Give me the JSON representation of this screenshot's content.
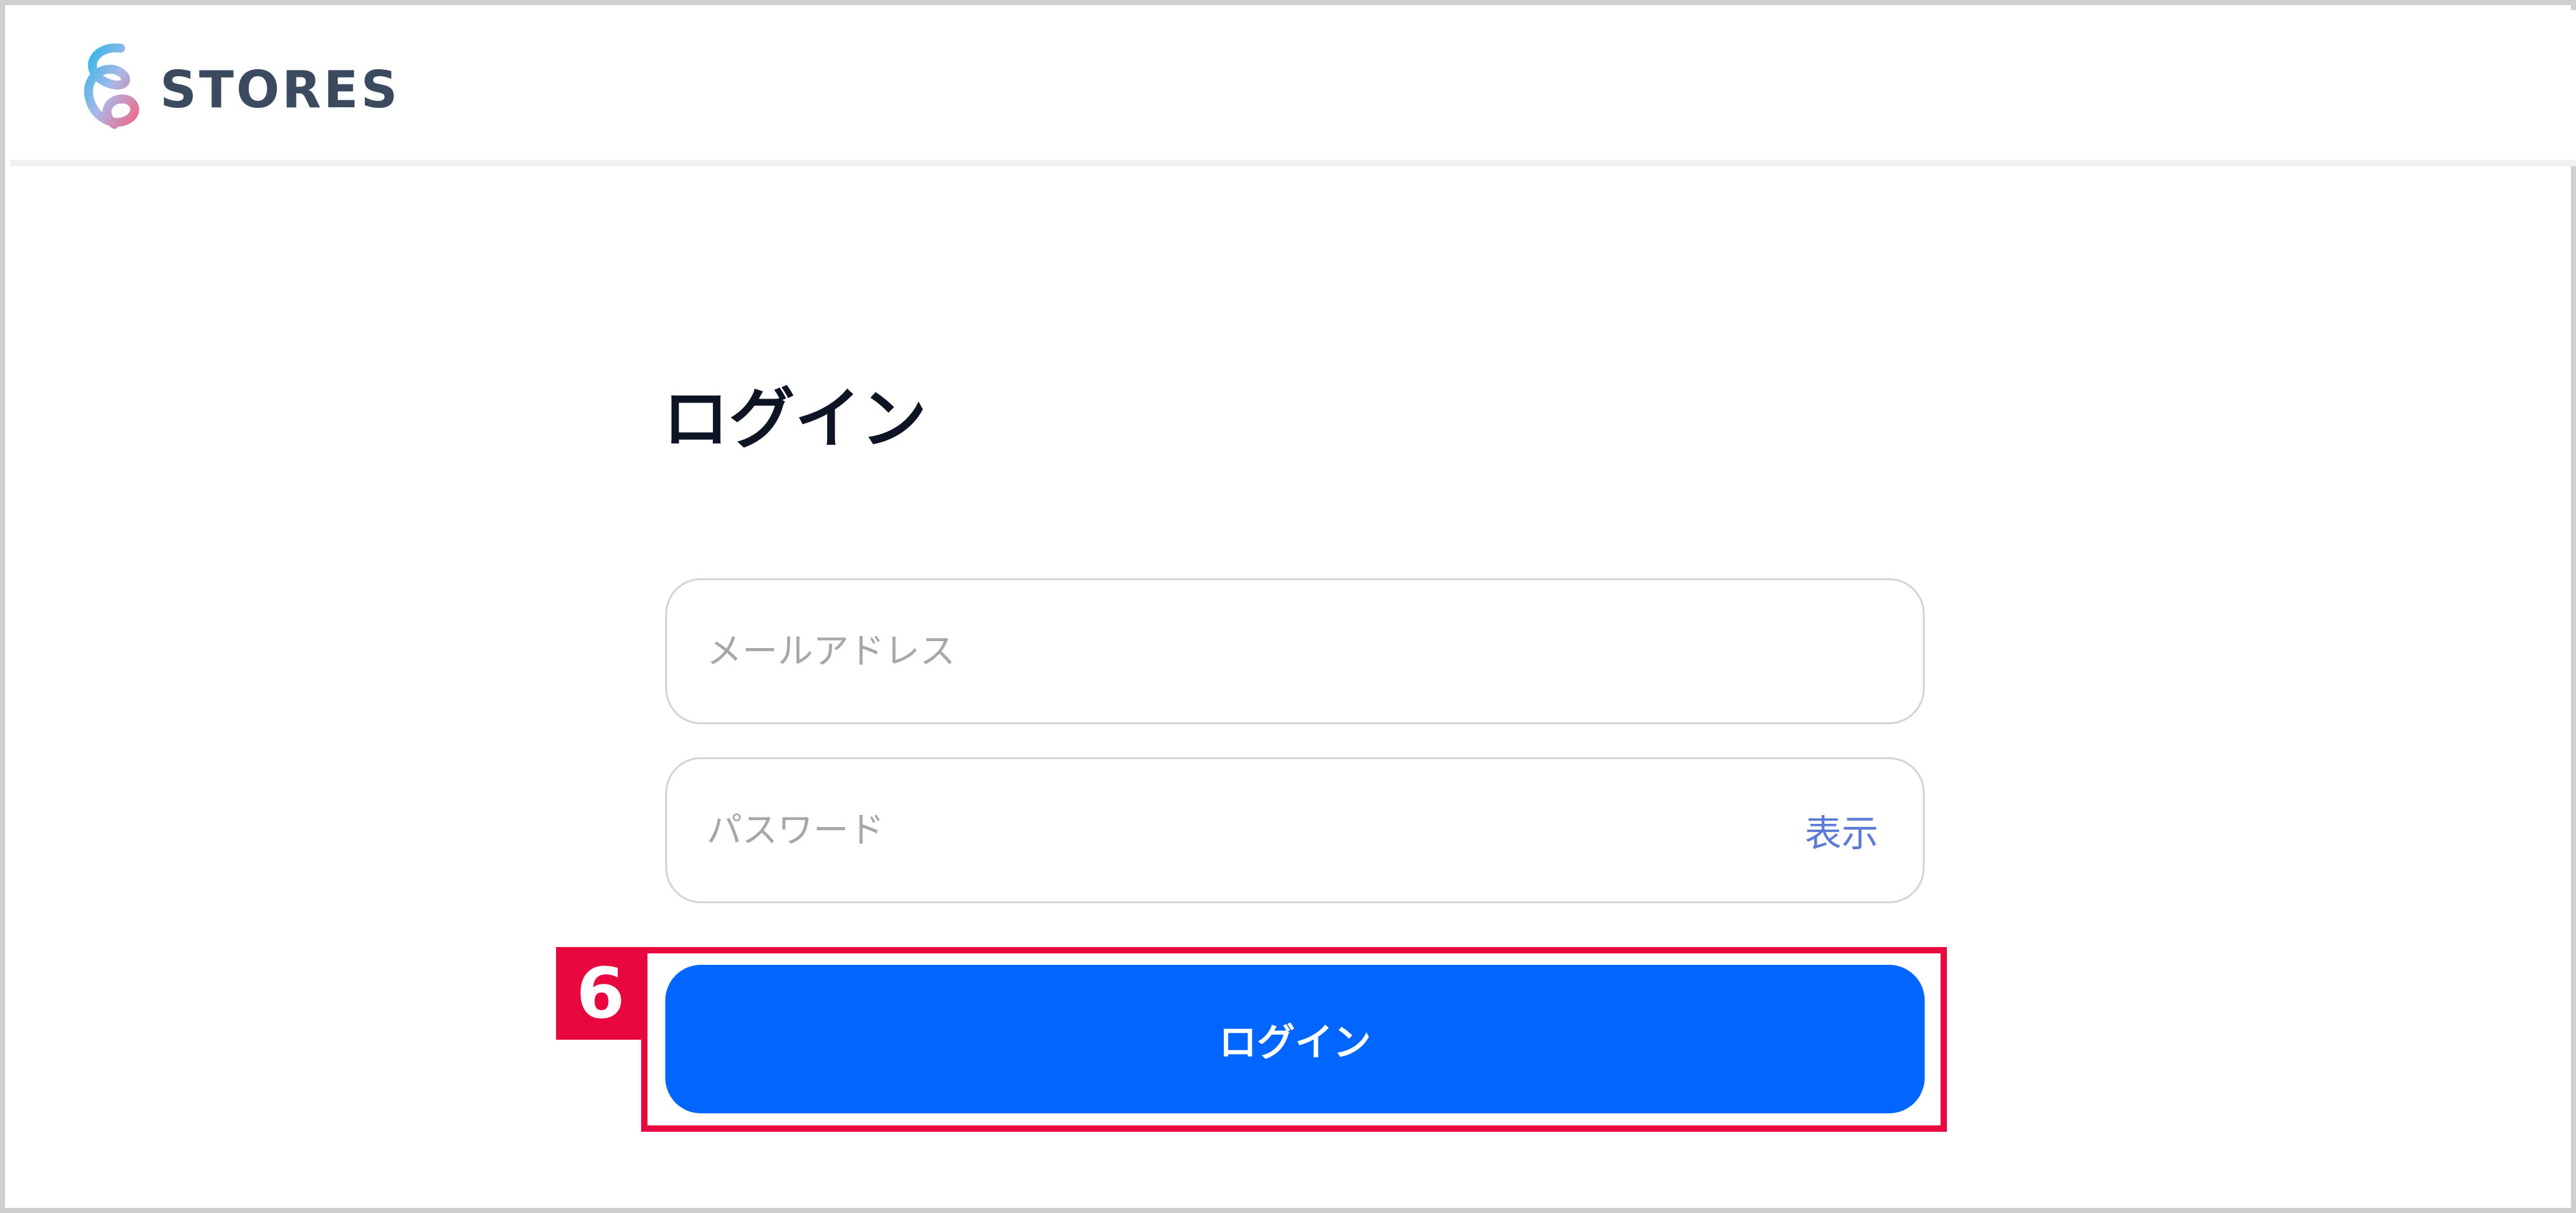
{
  "header": {
    "brand_name": "STORES",
    "logo_icon": "stores-swirl-logo"
  },
  "login_form": {
    "title": "ログイン",
    "email": {
      "placeholder": "メールアドレス",
      "value": ""
    },
    "password": {
      "placeholder": "パスワード",
      "value": "",
      "show_label": "表示"
    },
    "submit_label": "ログイン"
  },
  "annotation": {
    "step_number": "6",
    "color": "#e8083f"
  },
  "colors": {
    "primary_button": "#0066ff",
    "show_link": "#5b7bd6",
    "brand_text": "#3b4a5e"
  }
}
